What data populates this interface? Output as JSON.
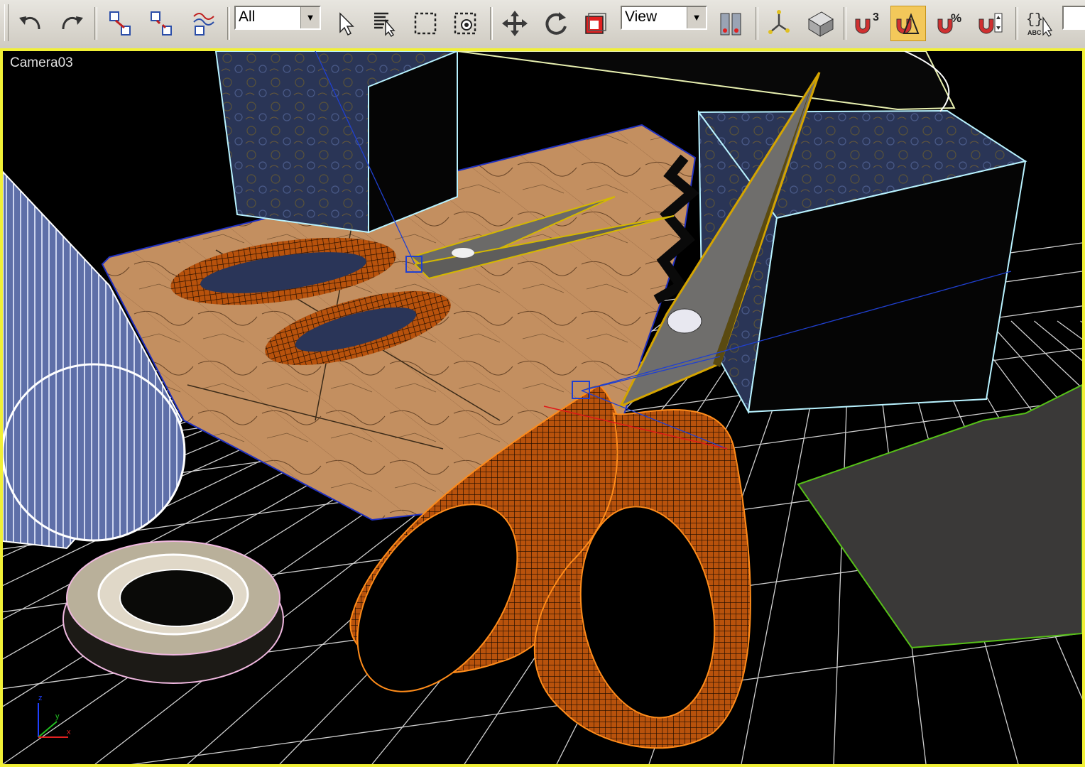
{
  "toolbar": {
    "selection_filter": {
      "value": "All"
    },
    "reference_coord": {
      "value": "View"
    },
    "buttons": [
      {
        "name": "undo-icon"
      },
      {
        "name": "redo-icon"
      },
      {
        "name": "select-and-link-icon"
      },
      {
        "name": "unlink-selection-icon"
      },
      {
        "name": "bind-to-space-warp-icon"
      },
      {
        "name": "select-object-icon"
      },
      {
        "name": "select-by-name-icon"
      },
      {
        "name": "rectangular-selection-icon"
      },
      {
        "name": "window-crossing-icon"
      },
      {
        "name": "select-and-move-icon"
      },
      {
        "name": "select-and-rotate-icon"
      },
      {
        "name": "select-and-scale-icon"
      },
      {
        "name": "use-pivot-point-center-icon"
      },
      {
        "name": "select-and-manipulate-icon"
      },
      {
        "name": "keyboard-shortcut-override-icon"
      },
      {
        "name": "snaps-toggle-icon",
        "label": "3"
      },
      {
        "name": "angle-snap-toggle-icon",
        "active": true
      },
      {
        "name": "percent-snap-toggle-icon",
        "label": "%"
      },
      {
        "name": "spinner-snap-toggle-icon"
      },
      {
        "name": "edit-named-selection-sets-icon",
        "label": "ABC"
      }
    ]
  },
  "viewport": {
    "label": "Camera03",
    "border_color": "#f1f037",
    "axis": {
      "x": "x",
      "y": "y",
      "z": "z"
    }
  },
  "colors": {
    "selection_orange": "#b8520c",
    "wire_orange": "#ff8c1a",
    "blade_gray": "#6f6e6c",
    "box_blue": "#2a3556",
    "map_tan": "#c38f60",
    "grid": "#cfcfcf"
  }
}
